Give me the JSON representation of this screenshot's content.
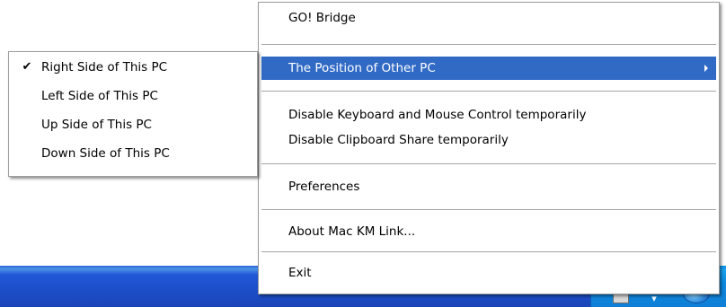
{
  "menu": {
    "title_item": "GO! Bridge",
    "position_item": "The Position of Other PC",
    "disable_kbm": "Disable Keyboard and Mouse Control temporarily",
    "disable_clipboard": "Disable Clipboard Share temporarily",
    "preferences": "Preferences",
    "about": "About Mac KM Link...",
    "exit": "Exit"
  },
  "submenu": {
    "check_glyph": "✔",
    "items": [
      "Right Side of This PC",
      "Left Side of This PC",
      "Up Side of This PC",
      "Down Side of This PC"
    ],
    "checked_index": 0
  },
  "colors": {
    "highlight": "#316ac5",
    "taskbar": "#245edb"
  },
  "icons": {
    "submenu_arrow": "chevron-right-icon",
    "checkmark": "checkmark-icon",
    "tray_network": "network-icon",
    "tray_expand": "chevron-down-icon",
    "tray_globe": "globe-icon"
  }
}
